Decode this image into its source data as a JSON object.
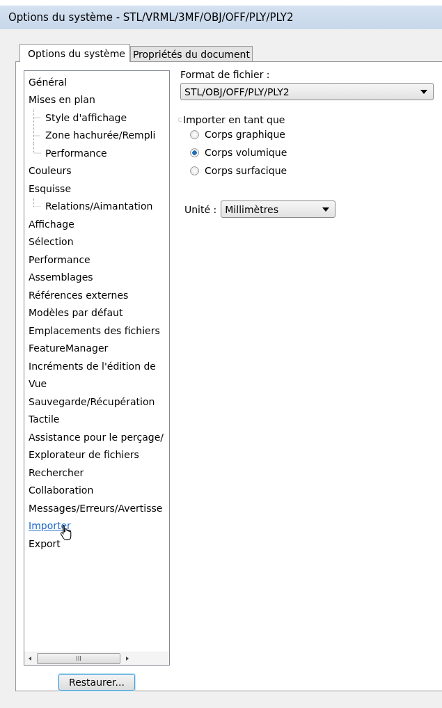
{
  "window": {
    "title": "Options du système - STL/VRML/3MF/OBJ/OFF/PLY/PLY2"
  },
  "tabs": [
    {
      "label": "Options du système",
      "selected": true
    },
    {
      "label": "Propriétés du document",
      "selected": false
    }
  ],
  "tree": {
    "items": [
      {
        "label": "Général",
        "hovered": false
      },
      {
        "label": "Mises en plan",
        "hovered": false,
        "children": [
          {
            "label": "Style d'affichage",
            "hovered": false
          },
          {
            "label": "Zone hachurée/Rempli",
            "hovered": false
          },
          {
            "label": "Performance",
            "hovered": false
          }
        ]
      },
      {
        "label": "Couleurs",
        "hovered": false
      },
      {
        "label": "Esquisse",
        "hovered": false,
        "children": [
          {
            "label": "Relations/Aimantation",
            "hovered": false
          }
        ]
      },
      {
        "label": "Affichage",
        "hovered": false
      },
      {
        "label": "Sélection",
        "hovered": false
      },
      {
        "label": "Performance",
        "hovered": false
      },
      {
        "label": "Assemblages",
        "hovered": false
      },
      {
        "label": "Références externes",
        "hovered": false
      },
      {
        "label": "Modèles par défaut",
        "hovered": false
      },
      {
        "label": "Emplacements des fichiers",
        "hovered": false
      },
      {
        "label": "FeatureManager",
        "hovered": false
      },
      {
        "label": "Incréments de l'édition de",
        "hovered": false
      },
      {
        "label": "Vue",
        "hovered": false
      },
      {
        "label": "Sauvegarde/Récupération",
        "hovered": false
      },
      {
        "label": "Tactile",
        "hovered": false
      },
      {
        "label": "Assistance pour le perçage/",
        "hovered": false
      },
      {
        "label": "Explorateur de fichiers",
        "hovered": false
      },
      {
        "label": "Rechercher",
        "hovered": false
      },
      {
        "label": "Collaboration",
        "hovered": false
      },
      {
        "label": "Messages/Erreurs/Avertisse",
        "hovered": false
      },
      {
        "label": "Importer",
        "hovered": true
      },
      {
        "label": "Export",
        "hovered": false
      }
    ],
    "scrollbar_glyph": "III"
  },
  "restore_button": "Restaurer...",
  "format": {
    "label": "Format de fichier :",
    "value": "STL/OBJ/OFF/PLY/PLY2"
  },
  "import_as": {
    "label": "Importer en tant que",
    "options": [
      {
        "label": "Corps graphique",
        "selected": false
      },
      {
        "label": "Corps volumique",
        "selected": true
      },
      {
        "label": "Corps surfacique",
        "selected": false
      }
    ]
  },
  "unit": {
    "label": "Unité :",
    "value": "Millimètres"
  }
}
